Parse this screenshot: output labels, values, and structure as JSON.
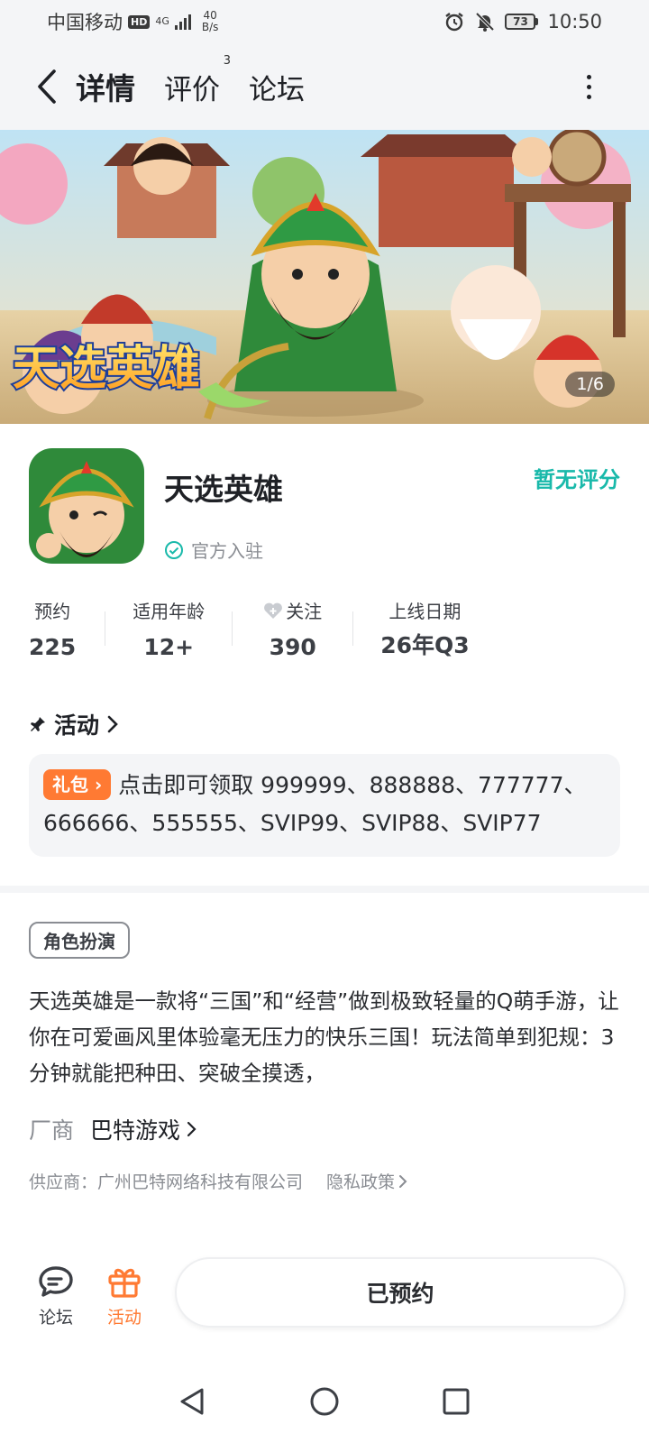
{
  "status_bar": {
    "carrier": "中国移动",
    "hd": "HD",
    "network": "4G",
    "speed_value": "40",
    "speed_unit": "B/s",
    "battery": "73",
    "time": "10:50"
  },
  "header": {
    "tabs": [
      {
        "label": "详情",
        "active": true
      },
      {
        "label": "评价",
        "badge": "3"
      },
      {
        "label": "论坛"
      }
    ]
  },
  "banner": {
    "logo_text": "天选英雄",
    "counter": "1/6"
  },
  "app": {
    "name": "天选英雄",
    "official_label": "官方入驻",
    "rating_status": "暂无评分"
  },
  "stats": [
    {
      "label": "预约",
      "value": "225"
    },
    {
      "label": "适用年龄",
      "value": "12+"
    },
    {
      "label": "关注",
      "value": "390",
      "icon": "heart-plus-icon"
    },
    {
      "label": "上线日期",
      "value": "26年Q3"
    }
  ],
  "activity": {
    "title": "活动",
    "tag": "礼包",
    "text": "点击即可领取 999999、888888、777777、666666、555555、SVIP99、SVIP88、SVIP77"
  },
  "description": {
    "genre_tag": "角色扮演",
    "text": "天选英雄是一款将“三国”和“经营”做到极致轻量的Q萌手游，让你在可爱画风里体验毫无压力的快乐三国！玩法简单到犯规：3分钟就能把种田、突破全摸透，",
    "vendor_label": "厂商",
    "vendor_name": "巴特游戏",
    "supplier": "供应商：广州巴特网络科技有限公司",
    "privacy": "隐私政策"
  },
  "bottom_bar": {
    "forum_label": "论坛",
    "activity_label": "活动",
    "reserve_label": "已预约"
  },
  "colors": {
    "accent_teal": "#27d3c5",
    "rating_teal": "#19b9aa",
    "orange": "#ff7a33"
  }
}
